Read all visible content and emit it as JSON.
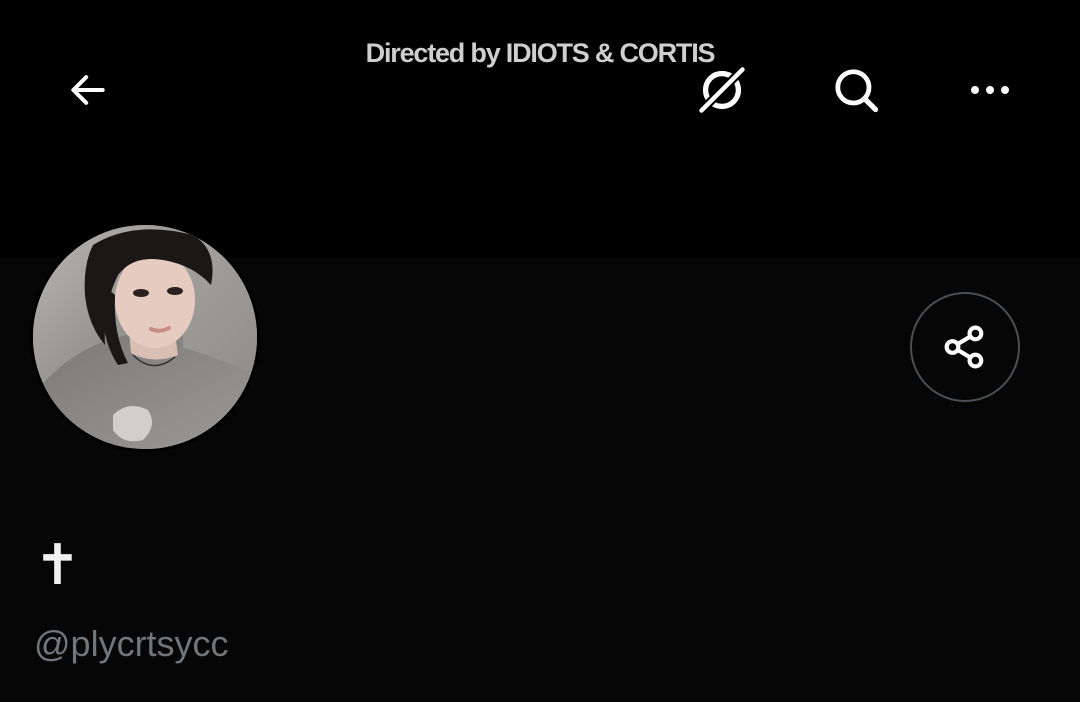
{
  "header": {
    "banner_text": "Directed by IDIOTS & CORTIS",
    "icons": {
      "back": "arrow-left-icon",
      "grok": "grok-icon",
      "search": "search-icon",
      "more": "more-horizontal-icon"
    }
  },
  "profile": {
    "display_name": "✝",
    "handle": "@plycrtsycc",
    "avatar": "avatar-photo",
    "share_icon": "share-icon"
  },
  "colors": {
    "background": "#000000",
    "handle": "#71767b",
    "share_border": "#4a4f53",
    "icon": "#ffffff"
  }
}
